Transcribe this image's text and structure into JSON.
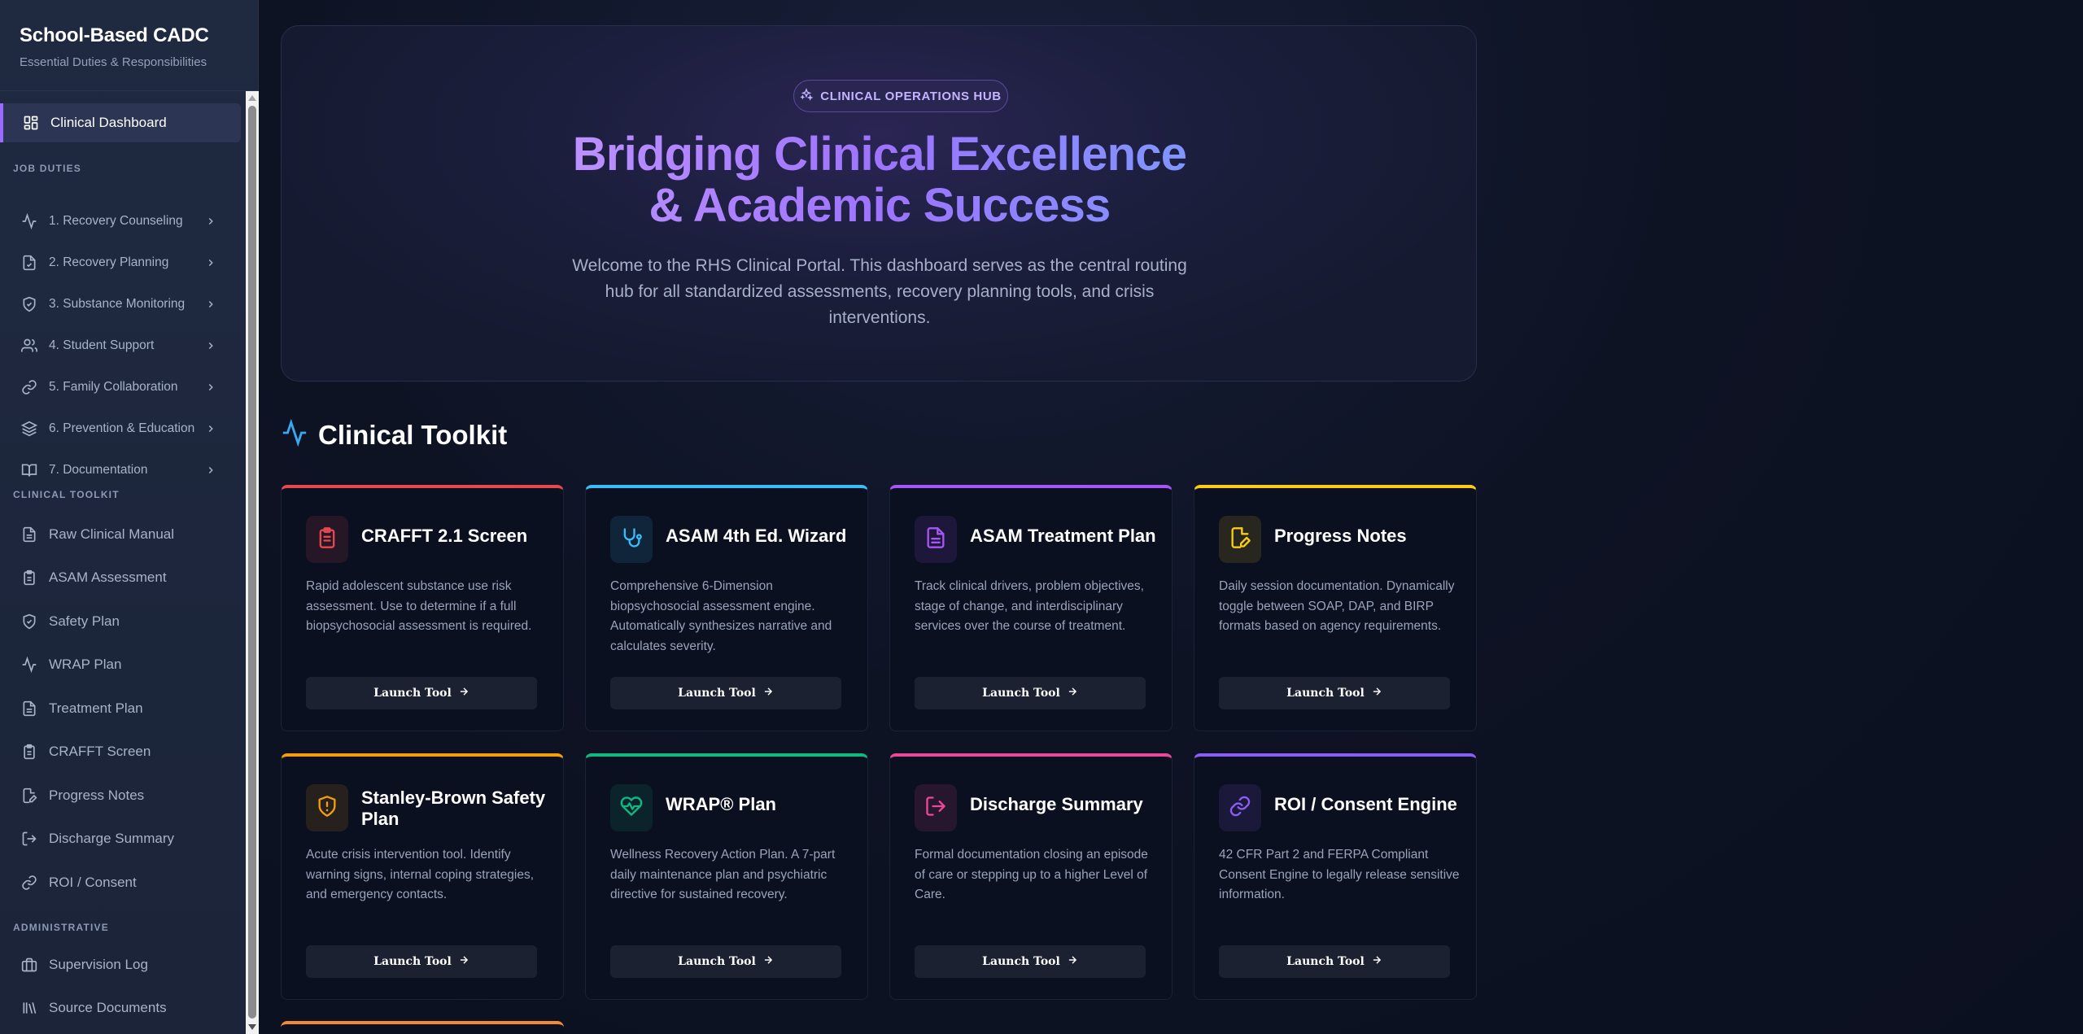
{
  "sidebar": {
    "title": "School-Based CADC",
    "subtitle": "Essential Duties & Responsibilities",
    "active": {
      "label": "Clinical Dashboard",
      "icon": "dashboard-icon"
    },
    "sections": {
      "job_duties": "JOB DUTIES",
      "clinical_toolkit": "CLINICAL TOOLKIT",
      "administrative": "ADMINISTRATIVE"
    },
    "duties": [
      {
        "label": "1. Recovery Counseling",
        "icon": "activity-icon"
      },
      {
        "label": "2. Recovery Planning",
        "icon": "file-check-icon"
      },
      {
        "label": "3. Substance Monitoring",
        "icon": "shield-check-icon"
      },
      {
        "label": "4. Student Support",
        "icon": "users-icon"
      },
      {
        "label": "5. Family Collaboration",
        "icon": "link-icon"
      },
      {
        "label": "6. Prevention & Education",
        "icon": "layers-icon"
      },
      {
        "label": "7. Documentation",
        "icon": "book-open-icon"
      }
    ],
    "toolkit": [
      {
        "label": "Raw Clinical Manual",
        "icon": "file-text-icon"
      },
      {
        "label": "ASAM Assessment",
        "icon": "clipboard-icon"
      },
      {
        "label": "Safety Plan",
        "icon": "shield-check-icon"
      },
      {
        "label": "WRAP Plan",
        "icon": "activity-icon"
      },
      {
        "label": "Treatment Plan",
        "icon": "file-text-icon"
      },
      {
        "label": "CRAFFT Screen",
        "icon": "clipboard-icon"
      },
      {
        "label": "Progress Notes",
        "icon": "edit-icon"
      },
      {
        "label": "Discharge Summary",
        "icon": "log-out-icon"
      },
      {
        "label": "ROI / Consent",
        "icon": "link-icon"
      }
    ],
    "admin": [
      {
        "label": "Supervision Log",
        "icon": "briefcase-icon"
      },
      {
        "label": "Source Documents",
        "icon": "library-icon"
      }
    ]
  },
  "hero": {
    "badge": "CLINICAL OPERATIONS HUB",
    "title_line1": "Bridging Clinical Excellence",
    "title_line2": "& Academic Success",
    "description": "Welcome to the RHS Clinical Portal. This dashboard serves as the central routing hub for all standardized assessments, recovery planning tools, and crisis interventions."
  },
  "toolkit": {
    "heading": "Clinical Toolkit",
    "button_label": "Launch Tool",
    "cards": [
      {
        "title": "CRAFFT 2.1 Screen",
        "desc": "Rapid adolescent substance use risk assessment. Use to determine if a full biopsychosocial assessment is required.",
        "accent": "#e5484d",
        "icon": "clipboard-icon"
      },
      {
        "title": "ASAM 4th Ed. Wizard",
        "desc": "Comprehensive 6-Dimension biopsychosocial assessment engine. Automatically synthesizes narrative and calculates severity.",
        "accent": "#38bdf8",
        "icon": "stethoscope-icon"
      },
      {
        "title": "ASAM Treatment Plan",
        "desc": "Track clinical drivers, problem objectives, stage of change, and interdisciplinary services over the course of treatment.",
        "accent": "#a855f7",
        "icon": "file-text-icon"
      },
      {
        "title": "Progress Notes",
        "desc": "Daily session documentation. Dynamically toggle between SOAP, DAP, and BIRP formats based on agency requirements.",
        "accent": "#facc15",
        "icon": "file-edit-icon"
      },
      {
        "title": "Stanley-Brown Safety Plan",
        "desc": "Acute crisis intervention tool. Identify warning signs, internal coping strategies, and emergency contacts.",
        "accent": "#f59e0b",
        "icon": "shield-alert-icon"
      },
      {
        "title": "WRAP® Plan",
        "desc": "Wellness Recovery Action Plan. A 7-part daily maintenance plan and psychiatric directive for sustained recovery.",
        "accent": "#10b981",
        "icon": "heart-pulse-icon"
      },
      {
        "title": "Discharge Summary",
        "desc": "Formal documentation closing an episode of care or stepping up to a higher Level of Care.",
        "accent": "#ec4899",
        "icon": "log-out-icon"
      },
      {
        "title": "ROI / Consent Engine",
        "desc": "42 CFR Part 2 and FERPA Compliant Consent Engine to legally release sensitive information.",
        "accent": "#8b5cf6",
        "icon": "link-icon"
      }
    ]
  }
}
